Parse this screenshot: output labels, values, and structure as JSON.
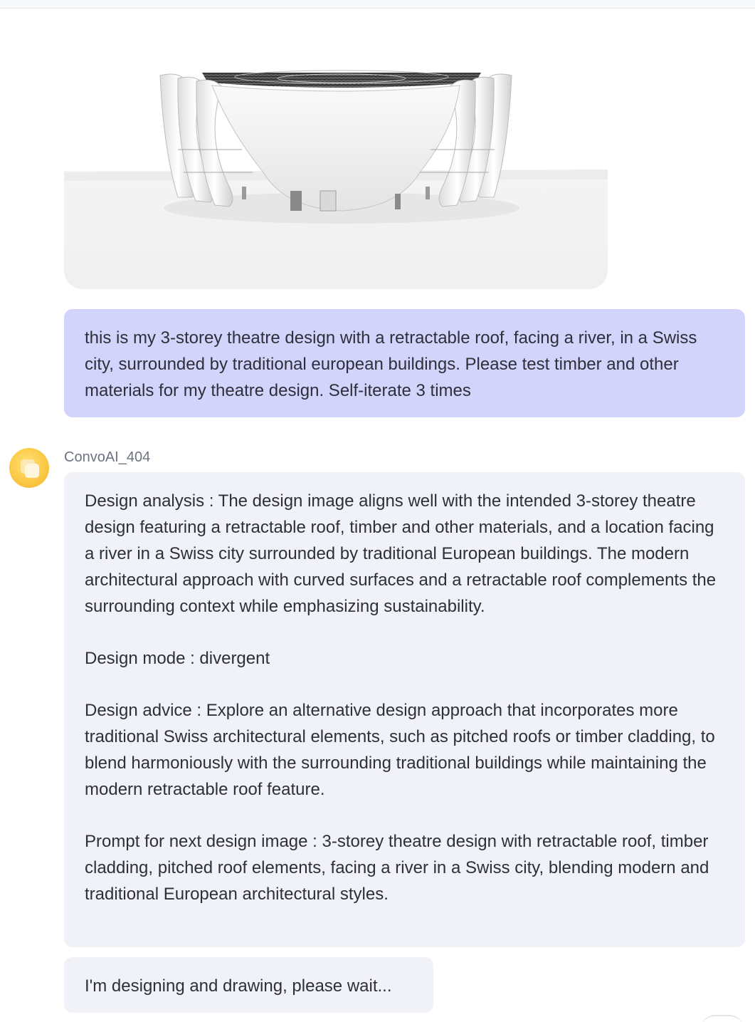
{
  "chat": {
    "image_alt": "3-storey theatre design render",
    "user_message": "this is my 3-storey theatre design with a retractable roof, facing a river, in a Swiss city, surrounded by traditional european buildings. Please test timber and other materials for my theatre design. Self-iterate 3 times",
    "bot_name": "ConvoAI_404",
    "bot_message": {
      "analysis": "Design analysis : The design image aligns well with the intended 3-storey theatre design featuring a retractable roof, timber and other materials, and a location facing a river in a Swiss city surrounded by traditional European buildings. The modern architectural approach with curved surfaces and a retractable roof complements the surrounding context while emphasizing sustainability.",
      "mode": "Design mode : divergent",
      "advice": "Design advice : Explore an alternative design approach that incorporates more traditional Swiss architectural elements, such as pitched roofs or timber cladding, to blend harmoniously with the surrounding traditional buildings while maintaining the modern retractable roof feature.",
      "prompt": "Prompt for next design image : 3-storey theatre design with retractable roof, timber cladding, pitched roof elements, facing a river in a Swiss city, blending modern and traditional European architectural styles."
    },
    "status_message": "I'm designing and drawing, please wait..."
  },
  "icons": {
    "avatar": "app-logo-icon"
  },
  "colors": {
    "user_bubble": "#d3d4fb",
    "bot_bubble": "#f1f2f7",
    "bot_name": "#6d7280",
    "avatar": "#fbc945"
  }
}
